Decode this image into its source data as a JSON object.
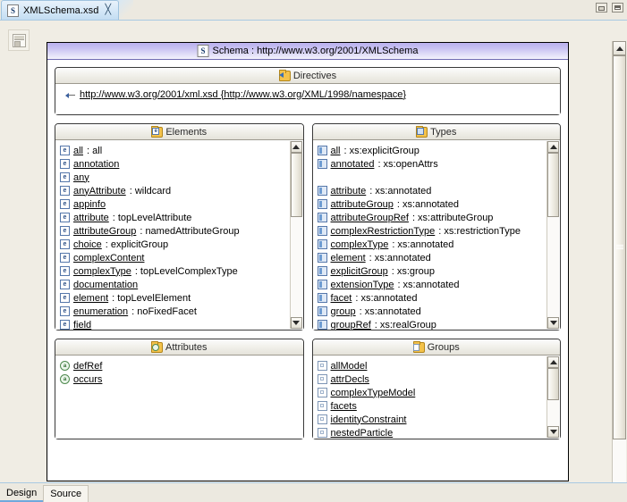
{
  "window": {
    "minimize_label": "minimize",
    "maximize_label": "maximize"
  },
  "editor_tab": {
    "title": "XMLSchema.xsd",
    "icon": "S",
    "close_glyph": "╳"
  },
  "toolbar": {
    "palette_tooltip": "Palette"
  },
  "schema": {
    "title": "Schema : http://www.w3.org/2001/XMLSchema",
    "icon": "S"
  },
  "directives": {
    "title": "Directives",
    "items": [
      {
        "label": "http://www.w3.org/2001/xml.xsd   {http://www.w3.org/XML/1998/namespace}"
      }
    ]
  },
  "elements": {
    "title": "Elements",
    "items": [
      {
        "name": "all",
        "type": ": all"
      },
      {
        "name": "annotation",
        "type": ""
      },
      {
        "name": "any",
        "type": ""
      },
      {
        "name": "anyAttribute",
        "type": ": wildcard"
      },
      {
        "name": "appinfo",
        "type": ""
      },
      {
        "name": "attribute",
        "type": ": topLevelAttribute"
      },
      {
        "name": "attributeGroup",
        "type": ": namedAttributeGroup"
      },
      {
        "name": "choice",
        "type": ": explicitGroup"
      },
      {
        "name": "complexContent",
        "type": ""
      },
      {
        "name": "complexType",
        "type": ": topLevelComplexType"
      },
      {
        "name": "documentation",
        "type": ""
      },
      {
        "name": "element",
        "type": ": topLevelElement"
      },
      {
        "name": "enumeration",
        "type": ": noFixedFacet"
      },
      {
        "name": "field",
        "type": ""
      }
    ]
  },
  "types": {
    "title": "Types",
    "items": [
      {
        "name": "all",
        "type": ": xs:explicitGroup"
      },
      {
        "name": "annotated",
        "type": ": xs:openAttrs"
      },
      {
        "blank": true
      },
      {
        "name": "attribute",
        "type": ": xs:annotated"
      },
      {
        "name": "attributeGroup",
        "type": ": xs:annotated"
      },
      {
        "name": "attributeGroupRef",
        "type": ": xs:attributeGroup"
      },
      {
        "name": "complexRestrictionType",
        "type": ": xs:restrictionType"
      },
      {
        "name": "complexType",
        "type": ": xs:annotated"
      },
      {
        "name": "element",
        "type": ": xs:annotated"
      },
      {
        "name": "explicitGroup",
        "type": ": xs:group"
      },
      {
        "name": "extensionType",
        "type": ": xs:annotated"
      },
      {
        "name": "facet",
        "type": ": xs:annotated"
      },
      {
        "name": "group",
        "type": ": xs:annotated"
      },
      {
        "name": "groupRef",
        "type": ": xs:realGroup"
      }
    ]
  },
  "attributes": {
    "title": "Attributes",
    "items": [
      {
        "name": "defRef",
        "type": ""
      },
      {
        "name": "occurs",
        "type": ""
      }
    ]
  },
  "groups": {
    "title": "Groups",
    "items": [
      {
        "name": "allModel",
        "type": ""
      },
      {
        "name": "attrDecls",
        "type": ""
      },
      {
        "name": "complexTypeModel",
        "type": ""
      },
      {
        "name": "facets",
        "type": ""
      },
      {
        "name": "identityConstraint",
        "type": ""
      },
      {
        "name": "nestedParticle",
        "type": ""
      }
    ]
  },
  "bottom_tabs": {
    "design": "Design",
    "source": "Source"
  },
  "colors": {
    "schema_header": "#b9b0ee",
    "tab_active": "#c3ddf2",
    "chrome": "#ece9e0",
    "accent": "#6fa8dc"
  }
}
